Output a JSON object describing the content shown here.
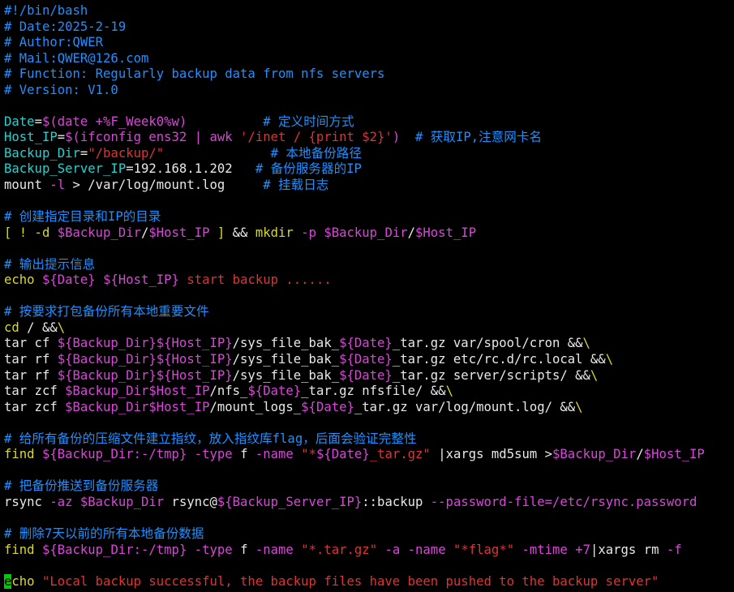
{
  "colors": {
    "comment": "#1e90ff",
    "white": "#e8e8e8",
    "cyan": "#22d3d3",
    "magenta": "#d946d9",
    "red": "#e23232",
    "yellow": "#d9d926",
    "cursor": "#00cc00"
  },
  "lines": [
    [
      [
        "comment",
        "#!/bin/bash"
      ]
    ],
    [
      [
        "comment",
        "# Date:2025-2-19"
      ]
    ],
    [
      [
        "comment",
        "# Author:QWER"
      ]
    ],
    [
      [
        "comment",
        "# Mail:QWER@126.com"
      ]
    ],
    [
      [
        "comment",
        "# Function: Regularly backup data from nfs servers"
      ]
    ],
    [
      [
        "comment",
        "# Version: V1.0"
      ]
    ],
    [],
    [
      [
        "cyan",
        "Date"
      ],
      [
        "white",
        "="
      ],
      [
        "magenta",
        "$(date +%F_Week0%w)"
      ],
      [
        "white",
        "          "
      ],
      [
        "comment",
        "# 定义时间方式"
      ]
    ],
    [
      [
        "cyan",
        "Host_IP"
      ],
      [
        "white",
        "="
      ],
      [
        "magenta",
        "$(ifconfig ens32 | awk "
      ],
      [
        "red",
        "'/inet / {print $2}'"
      ],
      [
        "magenta",
        ")"
      ],
      [
        "white",
        "  "
      ],
      [
        "comment",
        "# 获取IP,注意网卡名"
      ]
    ],
    [
      [
        "cyan",
        "Backup_Dir"
      ],
      [
        "white",
        "="
      ],
      [
        "red",
        "\"/backup/\""
      ],
      [
        "white",
        "              "
      ],
      [
        "comment",
        "# 本地备份路径"
      ]
    ],
    [
      [
        "cyan",
        "Backup_Server_IP"
      ],
      [
        "white",
        "=192.168.1.202   "
      ],
      [
        "comment",
        "# 备份服务器的IP"
      ]
    ],
    [
      [
        "white",
        "mount "
      ],
      [
        "magenta",
        "-l"
      ],
      [
        "white",
        " > /var/log/mount.log     "
      ],
      [
        "comment",
        "# 挂载日志"
      ]
    ],
    [],
    [
      [
        "comment",
        "# 创建指定目录和IP的目录"
      ]
    ],
    [
      [
        "yellow",
        "[ ! -d "
      ],
      [
        "magenta",
        "$Backup_Dir"
      ],
      [
        "white",
        "/"
      ],
      [
        "magenta",
        "$Host_IP"
      ],
      [
        "yellow",
        " ]"
      ],
      [
        "white",
        " && "
      ],
      [
        "yellow",
        "mkdir "
      ],
      [
        "magenta",
        "-p $Backup_Dir"
      ],
      [
        "white",
        "/"
      ],
      [
        "magenta",
        "$Host_IP"
      ]
    ],
    [],
    [
      [
        "comment",
        "# 输出提示信息"
      ]
    ],
    [
      [
        "yellow",
        "echo "
      ],
      [
        "magenta",
        "${Date}"
      ],
      [
        "white",
        " "
      ],
      [
        "magenta",
        "${Host_IP}"
      ],
      [
        "red",
        " start backup ......"
      ]
    ],
    [],
    [
      [
        "comment",
        "# 按要求打包备份所有本地重要文件"
      ]
    ],
    [
      [
        "yellow",
        "cd"
      ],
      [
        "white",
        " / &&"
      ],
      [
        "yellow",
        "\\"
      ]
    ],
    [
      [
        "white",
        "tar cf "
      ],
      [
        "magenta",
        "${Backup_Dir}${Host_IP}"
      ],
      [
        "white",
        "/sys_file_bak_"
      ],
      [
        "magenta",
        "${Date}"
      ],
      [
        "white",
        "_tar.gz var/spool/cron &&"
      ],
      [
        "yellow",
        "\\"
      ]
    ],
    [
      [
        "white",
        "tar rf "
      ],
      [
        "magenta",
        "${Backup_Dir}${Host_IP}"
      ],
      [
        "white",
        "/sys_file_bak_"
      ],
      [
        "magenta",
        "${Date}"
      ],
      [
        "white",
        "_tar.gz etc/rc.d/rc.local &&"
      ],
      [
        "yellow",
        "\\"
      ]
    ],
    [
      [
        "white",
        "tar rf "
      ],
      [
        "magenta",
        "${Backup_Dir}${Host_IP}"
      ],
      [
        "white",
        "/sys_file_bak_"
      ],
      [
        "magenta",
        "${Date}"
      ],
      [
        "white",
        "_tar.gz server/scripts/ &&"
      ],
      [
        "yellow",
        "\\"
      ]
    ],
    [
      [
        "white",
        "tar zcf "
      ],
      [
        "magenta",
        "$Backup_Dir$Host_IP"
      ],
      [
        "white",
        "/nfs_"
      ],
      [
        "magenta",
        "${Date}"
      ],
      [
        "white",
        "_tar.gz nfsfile/ &&"
      ],
      [
        "yellow",
        "\\"
      ]
    ],
    [
      [
        "white",
        "tar zcf "
      ],
      [
        "magenta",
        "$Backup_Dir$Host_IP"
      ],
      [
        "white",
        "/mount_logs_"
      ],
      [
        "magenta",
        "${Date}"
      ],
      [
        "white",
        "_tar.gz var/log/mount.log/ &&"
      ],
      [
        "yellow",
        "\\"
      ]
    ],
    [],
    [
      [
        "comment",
        "# 给所有备份的压缩文件建立指纹，放入指纹库flag，后面会验证完整性"
      ]
    ],
    [
      [
        "yellow",
        "find "
      ],
      [
        "magenta",
        "${Backup_Dir:-/tmp}"
      ],
      [
        "white",
        " "
      ],
      [
        "magenta",
        "-type"
      ],
      [
        "white",
        " f "
      ],
      [
        "magenta",
        "-name"
      ],
      [
        "white",
        " "
      ],
      [
        "red",
        "\"*"
      ],
      [
        "magenta",
        "${Date}"
      ],
      [
        "red",
        "_tar.gz\""
      ],
      [
        "white",
        " |xargs md5sum >"
      ],
      [
        "magenta",
        "$Backup_Dir"
      ],
      [
        "white",
        "/"
      ],
      [
        "magenta",
        "$Host_IP"
      ]
    ],
    [],
    [
      [
        "comment",
        "# 把备份推送到备份服务器"
      ]
    ],
    [
      [
        "white",
        "rsync "
      ],
      [
        "magenta",
        "-az $Backup_Dir"
      ],
      [
        "white",
        " rsync@"
      ],
      [
        "magenta",
        "${Backup_Server_IP}"
      ],
      [
        "white",
        "::backup "
      ],
      [
        "magenta",
        "--password-file=/etc/rsync.password"
      ]
    ],
    [],
    [
      [
        "comment",
        "# 删除7天以前的所有本地备份数据"
      ]
    ],
    [
      [
        "yellow",
        "find "
      ],
      [
        "magenta",
        "${Backup_Dir:-/tmp}"
      ],
      [
        "white",
        " "
      ],
      [
        "magenta",
        "-type"
      ],
      [
        "white",
        " f "
      ],
      [
        "magenta",
        "-name"
      ],
      [
        "white",
        " "
      ],
      [
        "red",
        "\"*.tar.gz\""
      ],
      [
        "white",
        " "
      ],
      [
        "magenta",
        "-a -name"
      ],
      [
        "white",
        " "
      ],
      [
        "red",
        "\"*flag*\""
      ],
      [
        "white",
        " "
      ],
      [
        "magenta",
        "-mtime +7"
      ],
      [
        "white",
        "|xargs rm "
      ],
      [
        "magenta",
        "-f"
      ]
    ],
    [],
    [
      [
        "cursor",
        "e"
      ],
      [
        "yellow",
        "cho "
      ],
      [
        "red",
        "\"Local backup successful, the backup files have been pushed to the backup server\""
      ]
    ]
  ]
}
